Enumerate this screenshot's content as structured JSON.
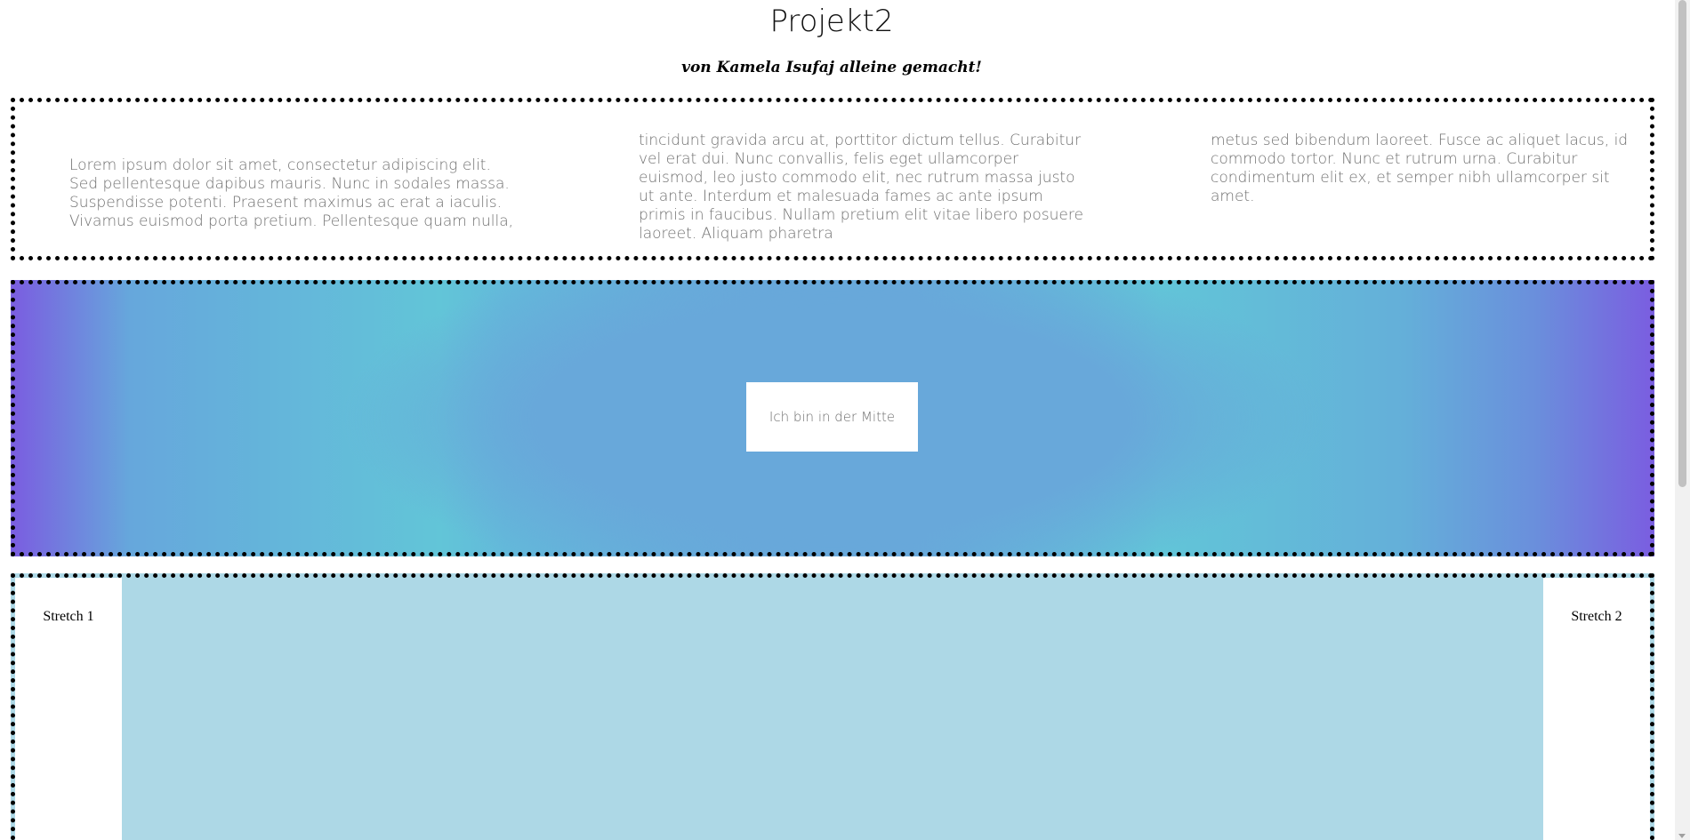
{
  "header": {
    "title": "Projekt2",
    "subtitle": "von Kamela Isufaj alleine gemacht!"
  },
  "text_section": {
    "columns": [
      "Lorem ipsum dolor sit amet, consectetur adipiscing elit. Sed pellentesque dapibus mauris. Nunc in sodales massa. Suspendisse potenti. Praesent maximus ac erat a iaculis. Vivamus euismod porta pretium. Pellentesque quam nulla,",
      "tincidunt gravida arcu at, porttitor dictum tellus. Curabitur vel erat dui. Nunc convallis, felis eget ullamcorper euismod, leo justo commodo elit, nec rutrum massa justo ut ante. Interdum et malesuada fames ac ante ipsum primis in faucibus. Nullam pretium elit vitae libero posuere laoreet. Aliquam pharetra",
      "metus sed bibendum laoreet. Fusce ac aliquet lacus, id commodo tortor. Nunc et rutrum urna. Curabitur condimentum elit ex, et semper nibh ullamcorper sit amet."
    ]
  },
  "gradient_section": {
    "center_label": "Ich bin in der Mitte",
    "colors": {
      "edge": "#7a5fe0",
      "cyan": "#62c5d8",
      "blue": "#67a9da"
    }
  },
  "stretch_section": {
    "left_label": "Stretch 1",
    "right_label": "Stretch 2",
    "middle_color": "#add8e6"
  },
  "scrollbar": {
    "icon": "chevron-down-icon"
  }
}
